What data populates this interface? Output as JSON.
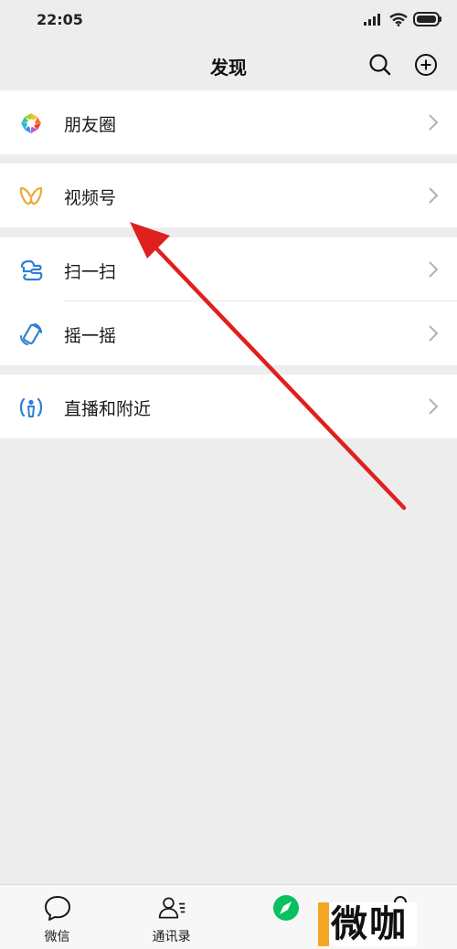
{
  "status_bar": {
    "time": "22:05",
    "icons": [
      "signal-icon",
      "wifi-icon",
      "battery-icon"
    ]
  },
  "header": {
    "title": "发现",
    "search_icon": "search-icon",
    "add_icon": "plus-circle-icon"
  },
  "menu": {
    "moments": {
      "label": "朋友圈",
      "icon": "moments-aperture-icon"
    },
    "channels": {
      "label": "视频号",
      "icon": "channels-butterfly-icon"
    },
    "scan": {
      "label": "扫一扫",
      "icon": "scan-icon"
    },
    "shake": {
      "label": "摇一摇",
      "icon": "shake-icon"
    },
    "live_nearby": {
      "label": "直播和附近",
      "icon": "live-nearby-icon"
    }
  },
  "tabbar": {
    "chats": {
      "label": "微信",
      "icon": "chat-bubble-icon"
    },
    "contacts": {
      "label": "通讯录",
      "icon": "contacts-icon"
    },
    "discover": {
      "icon": "compass-icon"
    },
    "me": {
      "icon": "person-icon"
    }
  },
  "annotation": {
    "arrow_color": "#e0201e",
    "points_to": "视频号"
  },
  "watermark": {
    "text": "微咖"
  },
  "colors": {
    "accent": "#07c160",
    "background": "#ededed",
    "channels_icon": "#f0a73a",
    "blue_icon": "#2d7fd3"
  }
}
